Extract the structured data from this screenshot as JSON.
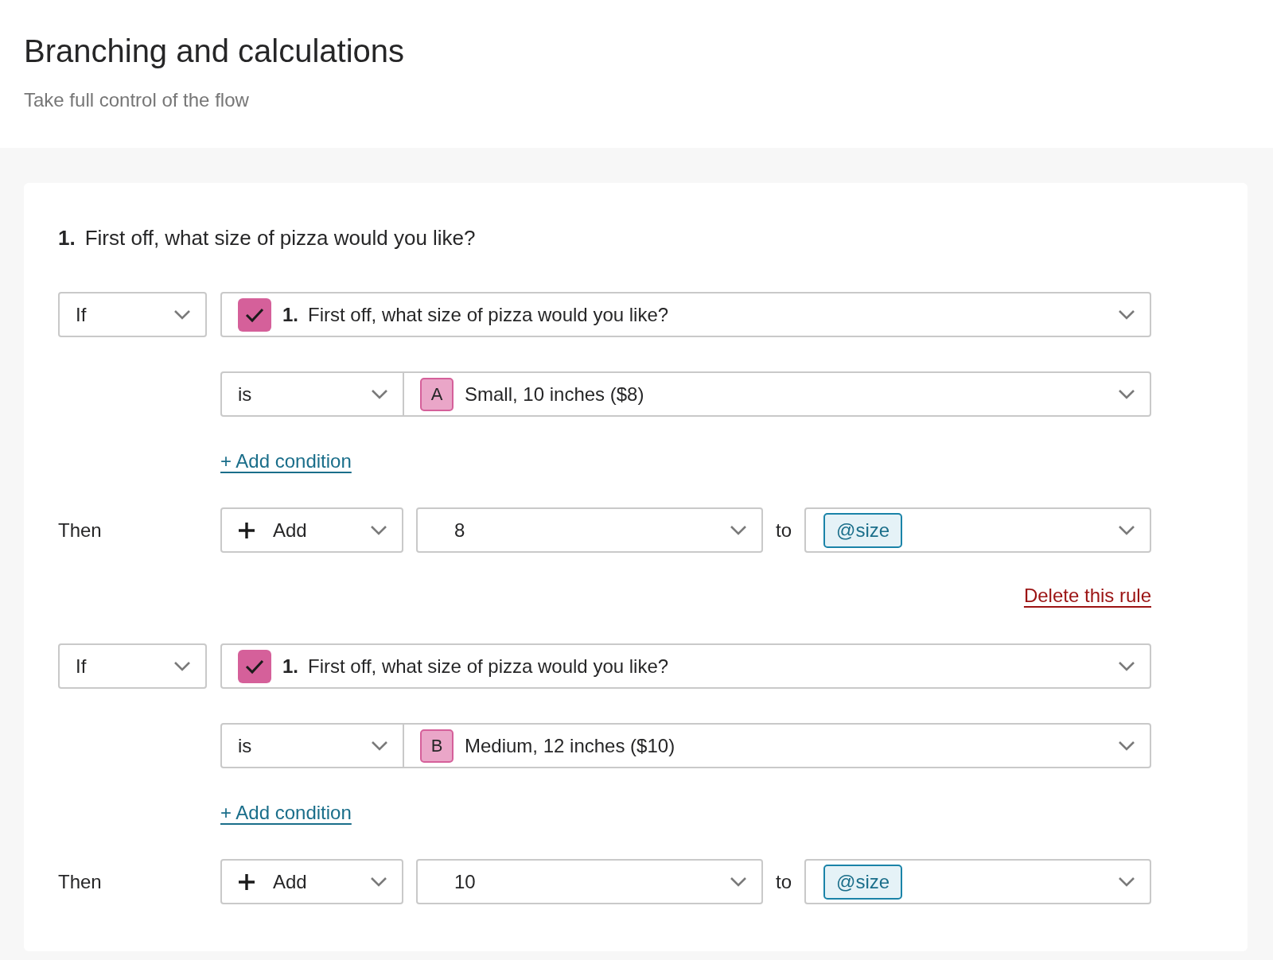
{
  "header": {
    "title": "Branching and calculations",
    "subtitle": "Take full control of the flow"
  },
  "question": {
    "number": "1.",
    "text": "First off, what size of pizza would you like?"
  },
  "rules": [
    {
      "logic": "If",
      "condition": {
        "checked": true,
        "number": "1.",
        "text": "First off, what size of pizza would you like?"
      },
      "operator": "is",
      "answer": {
        "letter": "A",
        "text": "Small, 10 inches ($8)"
      },
      "add_condition": "+ Add condition",
      "then_label": "Then",
      "action": "Add",
      "value": "8",
      "to_label": "to",
      "variable": "@size",
      "delete_link": "Delete this rule"
    },
    {
      "logic": "If",
      "condition": {
        "checked": true,
        "number": "1.",
        "text": "First off, what size of pizza would you like?"
      },
      "operator": "is",
      "answer": {
        "letter": "B",
        "text": "Medium, 12 inches ($10)"
      },
      "add_condition": "+ Add condition",
      "then_label": "Then",
      "action": "Add",
      "value": "10",
      "to_label": "to",
      "variable": "@size"
    }
  ]
}
